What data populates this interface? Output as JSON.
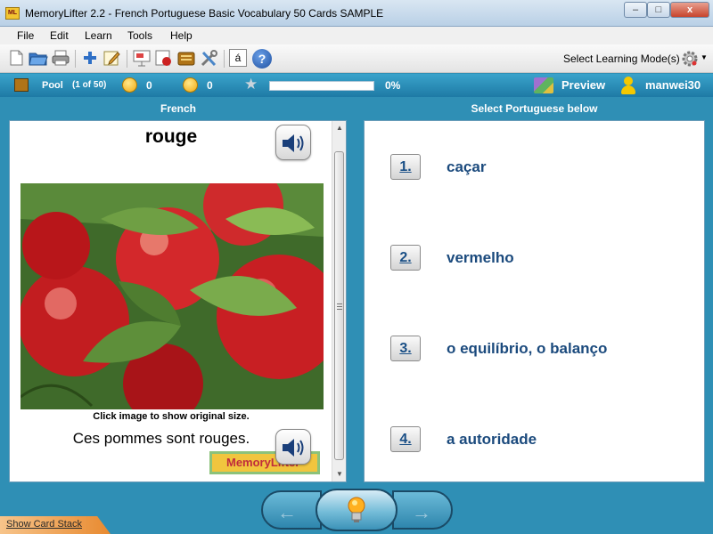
{
  "window": {
    "icon_text": "ML",
    "title": "MemoryLifter 2.2 - French Portuguese Basic Vocabulary 50 Cards SAMPLE",
    "minimize": "–",
    "maximize": "□",
    "close": "x"
  },
  "menu": [
    "File",
    "Edit",
    "Learn",
    "Tools",
    "Help"
  ],
  "toolbar": {
    "icons": [
      "new-icon",
      "open-icon",
      "print-icon",
      "add-icon",
      "edit-icon",
      "slideshow-icon",
      "record-icon",
      "card-box-icon",
      "tools-icon",
      "character-map-icon",
      "help-icon"
    ],
    "char_map_glyph": "á",
    "help_glyph": "?",
    "learning_mode_label": "Select Learning Mode(s)"
  },
  "status": {
    "pool_label": "Pool",
    "pool_position": "(1 of 50)",
    "correct_count": "0",
    "wrong_count": "0",
    "progress_percent": 0,
    "progress_text": "0%",
    "preview_label": "Preview",
    "username": "manwei30"
  },
  "question": {
    "header": "French",
    "word": "rouge",
    "image_caption": "Click image to show original size.",
    "example_sentence": "Ces pommes sont rouges.",
    "logo_text": "MemoryLifter"
  },
  "answers": {
    "header": "Select Portuguese below",
    "options": [
      {
        "number": "1.",
        "text": "caçar"
      },
      {
        "number": "2.",
        "text": "vermelho"
      },
      {
        "number": "3.",
        "text": "o equilíbrio, o balanço"
      },
      {
        "number": "4.",
        "text": "a autoridade"
      }
    ]
  },
  "bottom": {
    "show_card_stack": "Show Card Stack",
    "back_glyph": "←",
    "forward_glyph": "→"
  },
  "colors": {
    "background": "#2f8fb5",
    "answer_text": "#1b4a7d",
    "progress_fill": "#7cd07c"
  }
}
